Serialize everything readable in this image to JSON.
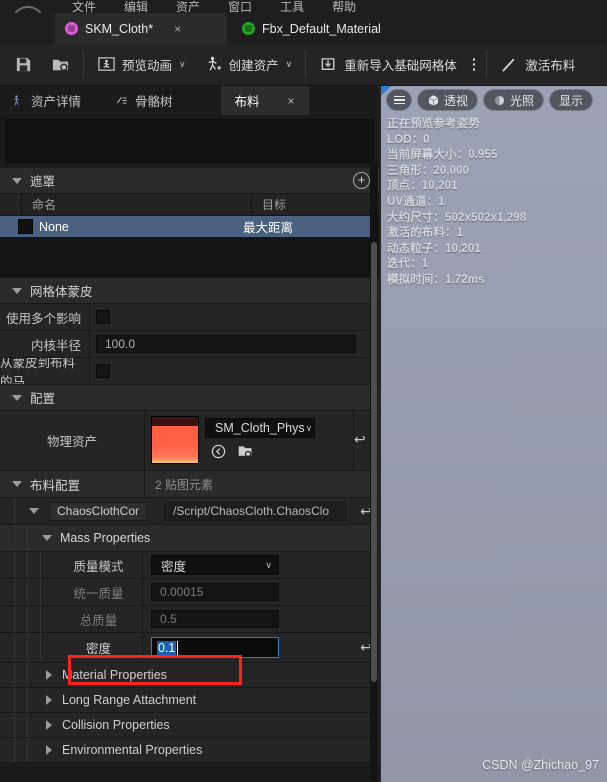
{
  "menu": {
    "items": [
      "文件",
      "编辑",
      "资产",
      "窗口",
      "工具",
      "帮助"
    ]
  },
  "tabs": [
    {
      "label": "SKM_Cloth*",
      "icon": "mesh-icon",
      "color": "#d85fd8",
      "active": true,
      "close": "×"
    },
    {
      "label": "Fbx_Default_Material",
      "icon": "material-icon",
      "color": "#27a327",
      "active": false,
      "close": ""
    }
  ],
  "toolbar": {
    "save_icon": "save-icon",
    "browse_icon": "browse-content-icon",
    "preview_anim": "预览动画",
    "create_asset": "创建资产",
    "reimport_base_mesh": "重新导入基础网格体",
    "activate_cloth": "激活布料",
    "caret": "∨"
  },
  "panel_tabs": [
    {
      "label": "资产详情",
      "icon": "asset-details-icon",
      "active": false
    },
    {
      "label": "骨骼树",
      "icon": "skeleton-tree-icon",
      "active": false
    },
    {
      "label": "布料",
      "icon": "",
      "active": true,
      "close": "×"
    }
  ],
  "search": {
    "placeholder": ""
  },
  "mask_section": {
    "title": "遮罩",
    "add_label": "+",
    "columns": [
      "",
      "命名",
      "目标"
    ],
    "rows": [
      {
        "name": "None",
        "target": "最大距离",
        "selected": true
      }
    ]
  },
  "mesh_skinning": {
    "title": "网格体蒙皮",
    "rows": [
      {
        "label": "使用多个影响",
        "type": "checkbox",
        "value": false
      },
      {
        "label": "内核半径",
        "type": "number",
        "value": "100.0"
      },
      {
        "label": "从蒙皮到布料的马",
        "type": "checkbox",
        "value": false
      }
    ]
  },
  "config_section": {
    "title": "配置",
    "physics_asset": {
      "label": "物理资产",
      "value": "SM_Cloth_Phys",
      "caret": "∨",
      "browse_icon": "browse-icon",
      "back_icon": "back-arrow-icon",
      "revert": "↩"
    }
  },
  "cloth_config": {
    "title": "布料配置",
    "count_label": "2 贴图元素",
    "entry": {
      "name": "ChaosClothCor",
      "path": "/Script/ChaosCloth.ChaosClo",
      "revert": "↩"
    },
    "mass_properties": {
      "title": "Mass Properties",
      "rows": [
        {
          "label": "质量模式",
          "type": "dropdown",
          "value": "密度",
          "caret": "∨",
          "dim": false
        },
        {
          "label": "统一质量",
          "type": "number",
          "value": "0.00015",
          "dim": true
        },
        {
          "label": "总质量",
          "type": "number",
          "value": "0.5",
          "dim": true
        },
        {
          "label": "密度",
          "type": "editing",
          "value": "0.1",
          "dim": false,
          "revert": "↩",
          "highlighted": true
        }
      ]
    },
    "collapsed_sections": [
      "Material Properties",
      "Long Range Attachment",
      "Collision Properties",
      "Environmental Properties"
    ]
  },
  "viewport": {
    "buttons": [
      {
        "label": "",
        "icon": "hamburger-icon"
      },
      {
        "label": "透视",
        "icon": "perspective-cube-icon"
      },
      {
        "label": "光照",
        "icon": "lighting-icon"
      },
      {
        "label": "显示",
        "icon": ""
      }
    ],
    "stats": [
      "正在预览参考姿势",
      "LOD：0",
      "当前屏幕大小：0.955",
      "三角形：20,000",
      "顶点：10,201",
      "UV通道：1",
      "大约尺寸：502x502x1,298",
      "激活的布料：1",
      "动态粒子：10,201",
      "迭代：1",
      "模拟时间：1.72ms"
    ],
    "watermark": "CSDN @Zhichao_97"
  },
  "colors": {
    "accent_blue": "#2d7fd6",
    "selection_blue": "#4a6280",
    "highlight_red": "#ff2020",
    "edit_border": "#2a7fd4",
    "text_select": "#1a5fb4"
  }
}
